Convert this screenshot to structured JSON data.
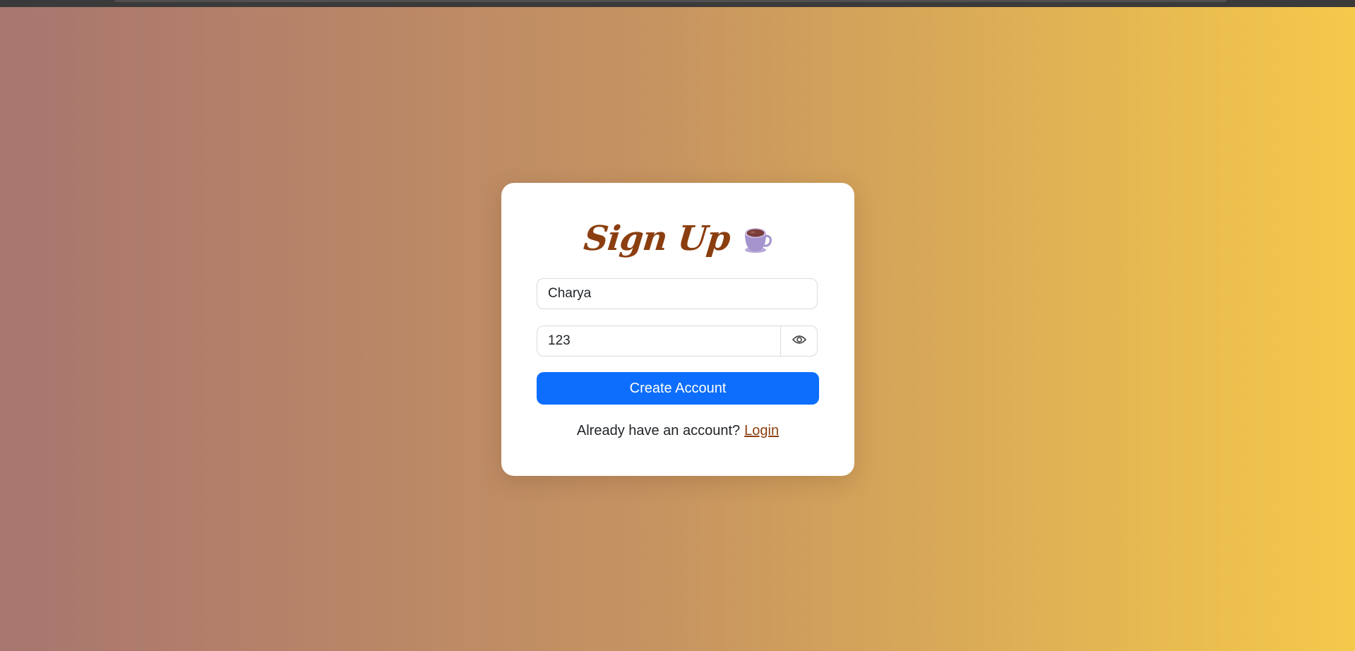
{
  "form": {
    "title": "Sign Up",
    "title_icon": "cup-icon",
    "username_value": "Charya",
    "password_value": "123",
    "password_toggle_icon": "eye-icon",
    "submit_label": "Create Account",
    "footer_text": "Already have an account?",
    "login_link": "Login"
  },
  "colors": {
    "title": "#8b3e0f",
    "primary_button": "#0d6efd",
    "link": "#8b3e0f",
    "background_start": "#a8756f",
    "background_end": "#f5c94b"
  }
}
